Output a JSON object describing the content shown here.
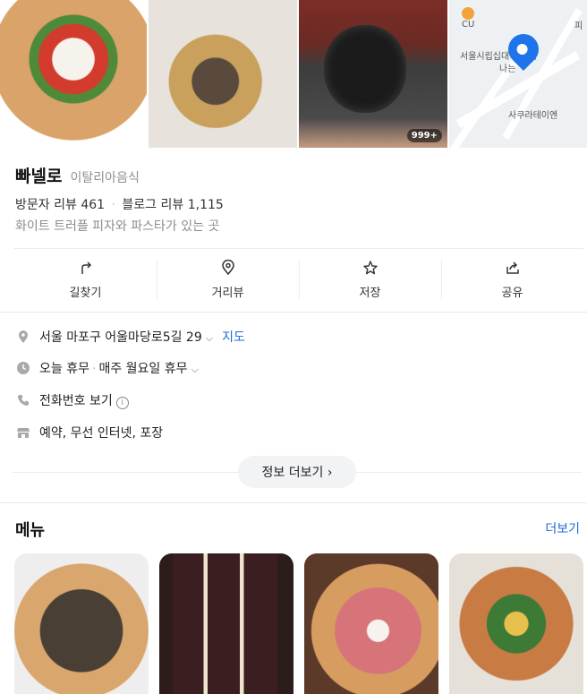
{
  "place": {
    "name": "빠넬로",
    "category": "이탈리아음식",
    "visitor_review_label": "방문자 리뷰",
    "visitor_review_count": "461",
    "blog_review_label": "블로그 리뷰",
    "blog_review_count": "1,115",
    "description": "화이트 트러플 피자와 파스타가 있는 곳"
  },
  "photos": {
    "count_badge": "999+",
    "map_labels": {
      "cu": "CU",
      "cu_sub": "피",
      "center": "서울시립십대 강센터",
      "near": "나는",
      "sakura": "사쿠라테이엔"
    }
  },
  "actions": [
    {
      "label": "길찾기",
      "icon": "directions-icon"
    },
    {
      "label": "거리뷰",
      "icon": "street-view-icon"
    },
    {
      "label": "저장",
      "icon": "star-icon"
    },
    {
      "label": "공유",
      "icon": "share-icon"
    }
  ],
  "info": {
    "address": "서울 마포구 어울마당로5길 29",
    "map_link": "지도",
    "hours_status": "오늘 휴무",
    "hours_detail": "매주 월요일 휴무",
    "phone": "전화번호 보기",
    "phone_info": "i",
    "amenities": "예약, 무선 인터넷, 포장"
  },
  "more_info_button": "정보 더보기",
  "more_info_chevron": "›",
  "menu": {
    "title": "메뉴",
    "more_link": "더보기"
  },
  "colors": {
    "accent_blue": "#1e6bd8",
    "map_pin": "#1e74e8"
  }
}
